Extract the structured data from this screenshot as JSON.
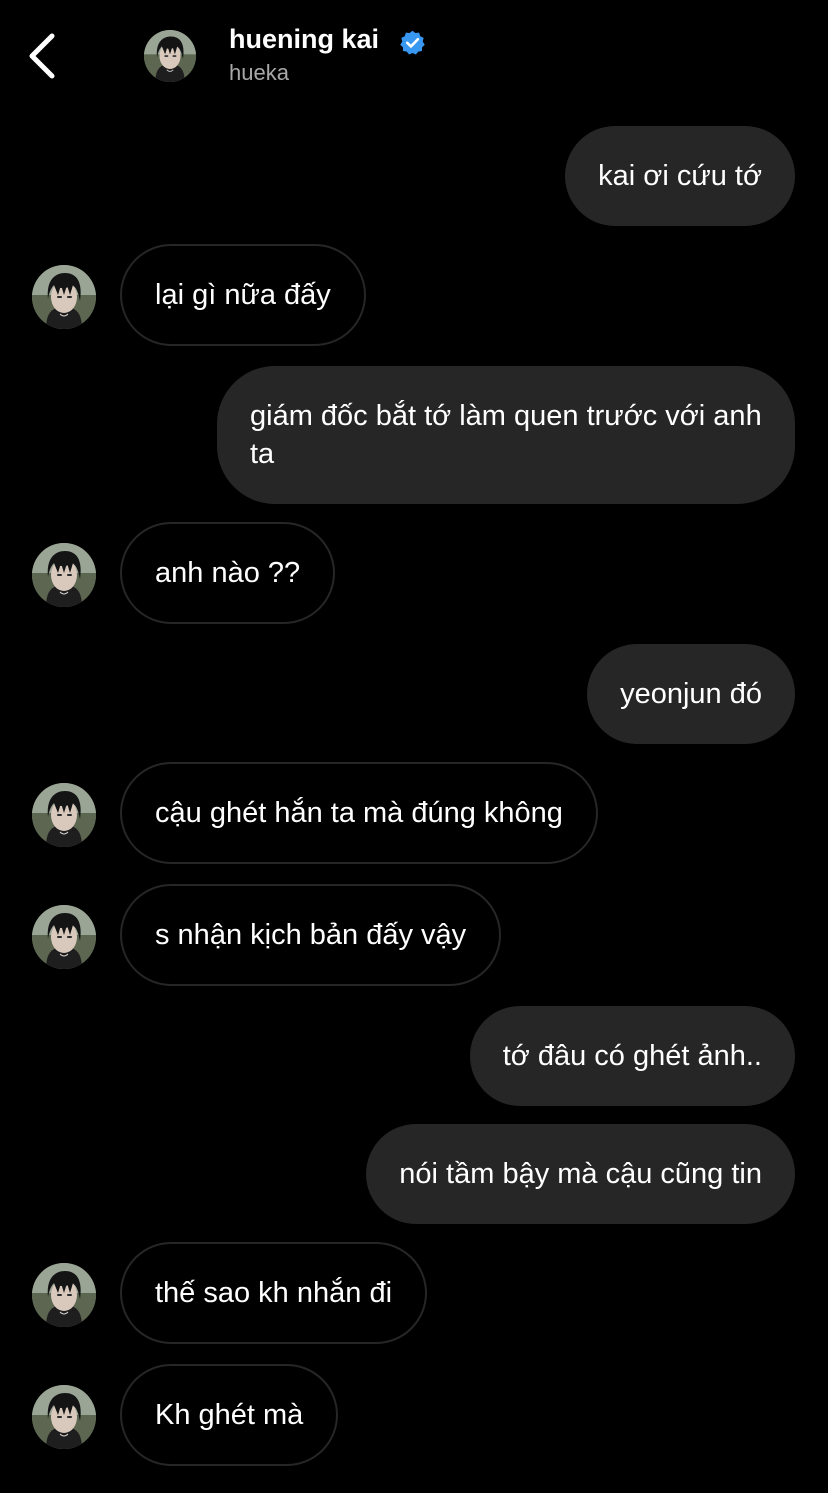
{
  "header": {
    "display_name": "huening kai",
    "username": "hueka",
    "back_icon": "chevron-left-icon",
    "verified_icon": "verified-badge-icon",
    "verified_color": "#3897f0"
  },
  "theme": {
    "background": "#000000",
    "outgoing_bubble": "#262626",
    "incoming_border": "#262626",
    "secondary_text": "#a8a8a8"
  },
  "messages": [
    {
      "direction": "outgoing",
      "text": "kai ơi cứu tớ"
    },
    {
      "direction": "incoming",
      "text": "lại gì nữa đấy"
    },
    {
      "direction": "outgoing",
      "text": "giám đốc bắt tớ làm quen trước với anh ta"
    },
    {
      "direction": "incoming",
      "text": "anh nào ??"
    },
    {
      "direction": "outgoing",
      "text": "yeonjun đó"
    },
    {
      "direction": "incoming",
      "text": "cậu ghét hắn ta mà đúng không"
    },
    {
      "direction": "incoming",
      "text": "s nhận kịch bản đấy vậy"
    },
    {
      "direction": "outgoing",
      "text": "tớ đâu có ghét ảnh.."
    },
    {
      "direction": "outgoing",
      "text": "nói tầm bậy mà cậu cũng tin"
    },
    {
      "direction": "incoming",
      "text": "thế sao kh nhắn đi"
    },
    {
      "direction": "incoming",
      "text": "Kh ghét mà"
    }
  ]
}
